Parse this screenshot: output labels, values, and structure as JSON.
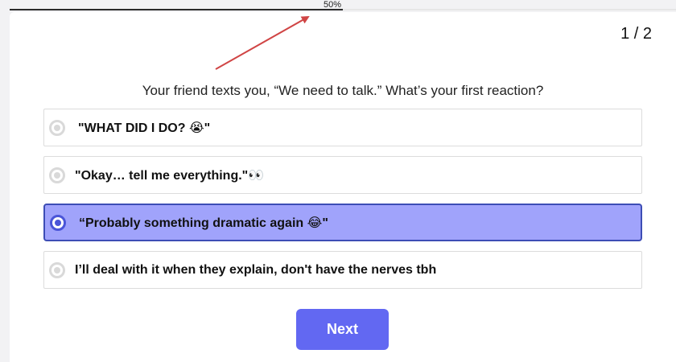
{
  "progress": {
    "label": "50%",
    "value": 0.5
  },
  "step": {
    "label": "1 / 2"
  },
  "question": {
    "text": "Your friend texts you, “We need to talk.” What’s your first reaction?"
  },
  "options": [
    {
      "text": "\"WHAT DID I DO? 😭\"",
      "selected": false
    },
    {
      "text": "\"Okay… tell me everything.\"👀",
      "selected": false
    },
    {
      "text": "“Probably something dramatic again 😂\"",
      "selected": true
    },
    {
      "text": "I’ll deal with it when they explain, don't have the nerves tbh",
      "selected": false
    }
  ],
  "next_button": {
    "label": "Next"
  },
  "colors": {
    "accent": "#6268f2",
    "selected_bg": "#a0a3fb",
    "selected_border": "#3d4db5",
    "annotation_arrow": "#d04545"
  }
}
